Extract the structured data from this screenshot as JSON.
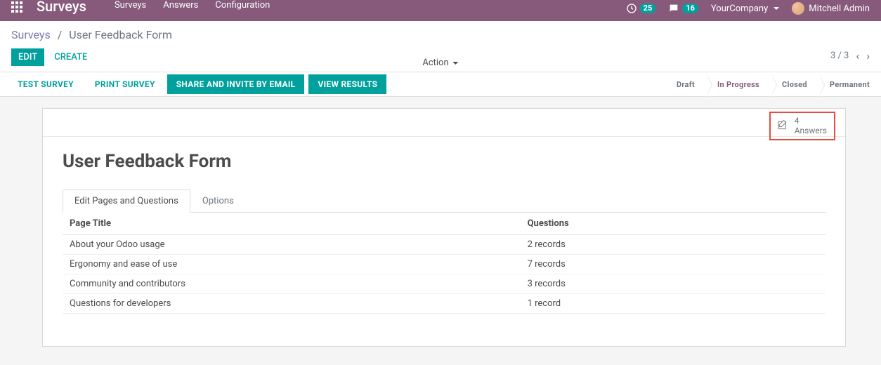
{
  "header": {
    "app_title": "Surveys",
    "nav": [
      "Surveys",
      "Answers",
      "Configuration"
    ],
    "activity_count": "25",
    "message_count": "16",
    "company": "YourCompany",
    "user": "Mitchell Admin"
  },
  "breadcrumb": {
    "root": "Surveys",
    "current": "User Feedback Form"
  },
  "buttons": {
    "edit": "Edit",
    "create": "Create",
    "action": "Action"
  },
  "pager": {
    "text": "3 / 3"
  },
  "action_bar": {
    "test": "Test Survey",
    "print": "Print Survey",
    "share": "Share and Invite by Email",
    "results": "View Results"
  },
  "status": {
    "draft": "Draft",
    "in_progress": "In Progress",
    "closed": "Closed",
    "permanent": "Permanent"
  },
  "answers_box": {
    "count": "4",
    "label": "Answers"
  },
  "form": {
    "title": "User Feedback Form",
    "tabs": {
      "edit": "Edit Pages and Questions",
      "options": "Options"
    },
    "columns": {
      "page_title": "Page Title",
      "questions": "Questions"
    },
    "rows": [
      {
        "title": "About your Odoo usage",
        "questions": "2 records"
      },
      {
        "title": "Ergonomy and ease of use",
        "questions": "7 records"
      },
      {
        "title": "Community and contributors",
        "questions": "3 records"
      },
      {
        "title": "Questions for developers",
        "questions": "1 record"
      }
    ]
  }
}
